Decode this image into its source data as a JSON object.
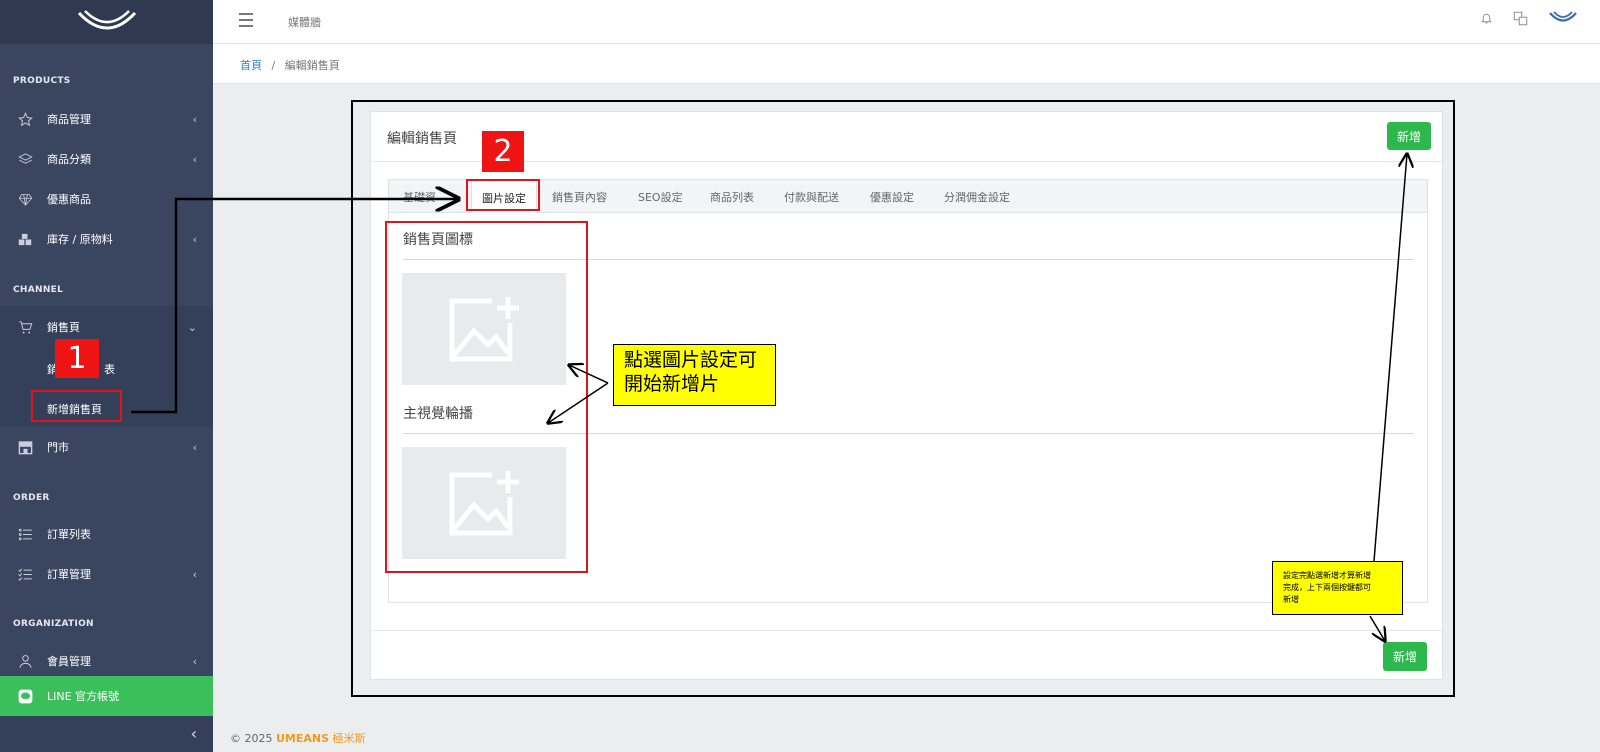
{
  "colors": {
    "sidebar": "#3a4660",
    "accent_green": "#2db84d",
    "line_green": "#3bbf5a",
    "annotation_red": "#e0141b",
    "note_yellow": "#ffff00",
    "link_blue": "#2e7fd1"
  },
  "header": {
    "title": "媒體牆"
  },
  "sidebar": {
    "sections": {
      "products": "PRODUCTS",
      "channel": "CHANNEL",
      "order": "ORDER",
      "organization": "ORGANIZATION"
    },
    "items": {
      "product_mgmt": "商品管理",
      "product_category": "商品分類",
      "promo_products": "優惠商品",
      "inventory": "庫存 / 原物料",
      "sales_page": "銷售頁",
      "sales_page_list_partial": "銷",
      "sales_page_list_tail": "表",
      "new_sales_page": "新增銷售頁",
      "store": "門市",
      "order_list": "訂單列表",
      "order_mgmt": "訂單管理",
      "member_mgmt": "會員管理",
      "line_official": "LINE 官方帳號"
    }
  },
  "breadcrumb": {
    "home": "首頁",
    "separator": "/",
    "current": "編輯銷售頁"
  },
  "card": {
    "title": "編輯銷售頁",
    "add_button": "新增",
    "tabs": [
      "基礎資訊",
      "圖片設定",
      "銷售頁內容",
      "SEO設定",
      "商品列表",
      "付款與配送",
      "優惠設定",
      "分潤佣金設定"
    ],
    "tab_first_visible": "基礎資",
    "active_tab": "圖片設定",
    "sections": {
      "icon": "銷售頁圖標",
      "carousel": "主視覺輪播"
    },
    "bottom_add_button": "新增"
  },
  "annotations": {
    "badge_1": "1",
    "badge_2": "2",
    "note_image_line1": "點選圖片設定可",
    "note_image_line2": "開始新增片",
    "note_save_line1": "設定完點選新增才算新增",
    "note_save_line2": "完成，上下兩個按鍵都可",
    "note_save_line3": "新增"
  },
  "footer": {
    "copyright": "© 2025",
    "brand": "UMEANS",
    "brand_cn": "極米斯"
  }
}
